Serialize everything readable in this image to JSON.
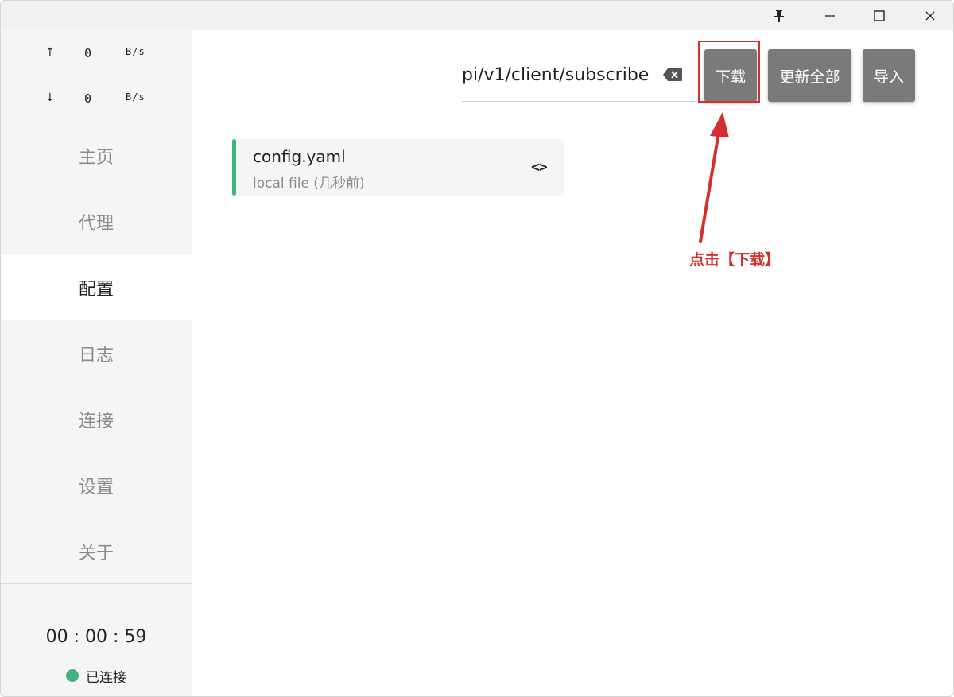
{
  "titlebar": {
    "icons": [
      "pin-icon",
      "minimize-icon",
      "maximize-icon",
      "close-icon"
    ]
  },
  "traffic": {
    "up_arrow": "↑",
    "up_value": "0",
    "up_unit": "B/s",
    "down_arrow": "↓",
    "down_value": "0",
    "down_unit": "B/s"
  },
  "sidebar": {
    "items": [
      {
        "label": "主页",
        "active": false
      },
      {
        "label": "代理",
        "active": false
      },
      {
        "label": "配置",
        "active": true
      },
      {
        "label": "日志",
        "active": false
      },
      {
        "label": "连接",
        "active": false
      },
      {
        "label": "设置",
        "active": false
      },
      {
        "label": "关于",
        "active": false
      }
    ],
    "timer": "00 : 00 : 59",
    "status_label": "已连接"
  },
  "header": {
    "url_value": "pi/v1/client/subscribe",
    "download_label": "下载",
    "update_all_label": "更新全部",
    "import_label": "导入"
  },
  "profiles": [
    {
      "name": "config.yaml",
      "subtitle": "local file (几秒前)",
      "code_glyph": "<>"
    }
  ],
  "annotation": {
    "text": "点击【下载】",
    "color": "#d32f2f"
  },
  "colors": {
    "accent": "#47b07f",
    "button": "#7a7a7a",
    "sidebar_bg": "#f4f5f5",
    "annotation": "#d32f2f"
  }
}
